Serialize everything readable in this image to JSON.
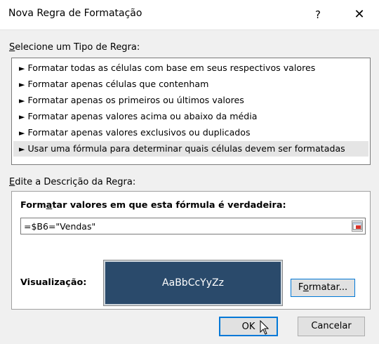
{
  "window": {
    "title": "Nova Regra de Formatação",
    "help_label": "?",
    "close_label": "✕"
  },
  "rule_type": {
    "label_access_key": "S",
    "label_rest": "elecione um Tipo de Regra:",
    "items": [
      {
        "label": "Formatar todas as células com base em seus respectivos valores"
      },
      {
        "label": "Formatar apenas células que contenham"
      },
      {
        "label": "Formatar apenas os primeiros ou últimos valores"
      },
      {
        "label": "Formatar apenas valores acima ou abaixo da média"
      },
      {
        "label": "Formatar apenas valores exclusivos ou duplicados"
      },
      {
        "label": "Usar uma fórmula para determinar quais células devem ser formatadas"
      }
    ],
    "selected_index": 5
  },
  "description": {
    "label_access_key": "E",
    "label_rest": "dite a Descrição da Regra:",
    "formula_label_pre": "Form",
    "formula_label_key": "a",
    "formula_label_post": "tar valores em que esta fórmula é verdadeira:",
    "formula_value": "=$B6=\"Vendas\"",
    "preview_label": "Visualização:",
    "preview_text": "AaBbCcYyZz",
    "preview_color": "#2a4a6b",
    "format_btn_pre": "F",
    "format_btn_key": "o",
    "format_btn_post": "rmatar..."
  },
  "footer": {
    "ok_label": "OK",
    "cancel_label": "Cancelar"
  },
  "colors": {
    "accent": "#0078d7"
  }
}
